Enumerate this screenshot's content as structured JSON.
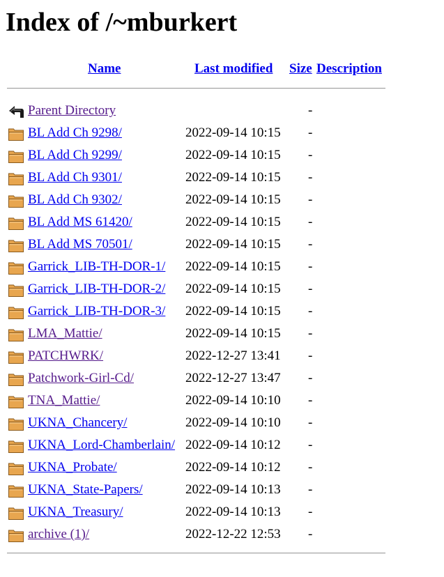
{
  "page": {
    "title": "Index of /~mburkert"
  },
  "columns": {
    "name": "Name",
    "last_modified": "Last modified",
    "size": "Size",
    "description": "Description"
  },
  "parent": {
    "label": "Parent Directory",
    "size": "-",
    "icon": "back-arrow-icon"
  },
  "entries": [
    {
      "name": "BL Add Ch 9298/",
      "modified": "2022-09-14 10:15",
      "size": "-",
      "visited": false,
      "icon": "folder-icon"
    },
    {
      "name": "BL Add Ch 9299/",
      "modified": "2022-09-14 10:15",
      "size": "-",
      "visited": false,
      "icon": "folder-icon"
    },
    {
      "name": "BL Add Ch 9301/",
      "modified": "2022-09-14 10:15",
      "size": "-",
      "visited": false,
      "icon": "folder-icon"
    },
    {
      "name": "BL Add Ch 9302/",
      "modified": "2022-09-14 10:15",
      "size": "-",
      "visited": false,
      "icon": "folder-icon"
    },
    {
      "name": "BL Add MS 61420/",
      "modified": "2022-09-14 10:15",
      "size": "-",
      "visited": false,
      "icon": "folder-icon"
    },
    {
      "name": "BL Add MS 70501/",
      "modified": "2022-09-14 10:15",
      "size": "-",
      "visited": false,
      "icon": "folder-icon"
    },
    {
      "name": "Garrick_LIB-TH-DOR-1/",
      "modified": "2022-09-14 10:15",
      "size": "-",
      "visited": false,
      "icon": "folder-icon"
    },
    {
      "name": "Garrick_LIB-TH-DOR-2/",
      "modified": "2022-09-14 10:15",
      "size": "-",
      "visited": false,
      "icon": "folder-icon"
    },
    {
      "name": "Garrick_LIB-TH-DOR-3/",
      "modified": "2022-09-14 10:15",
      "size": "-",
      "visited": false,
      "icon": "folder-icon"
    },
    {
      "name": "LMA_Mattie/",
      "modified": "2022-09-14 10:15",
      "size": "-",
      "visited": true,
      "icon": "folder-icon"
    },
    {
      "name": "PATCHWRK/",
      "modified": "2022-12-27 13:41",
      "size": "-",
      "visited": true,
      "icon": "folder-icon"
    },
    {
      "name": "Patchwork-Girl-Cd/",
      "modified": "2022-12-27 13:47",
      "size": "-",
      "visited": true,
      "icon": "folder-icon"
    },
    {
      "name": "TNA_Mattie/",
      "modified": "2022-09-14 10:10",
      "size": "-",
      "visited": true,
      "icon": "folder-icon"
    },
    {
      "name": "UKNA_Chancery/",
      "modified": "2022-09-14 10:10",
      "size": "-",
      "visited": false,
      "icon": "folder-icon"
    },
    {
      "name": "UKNA_Lord-Chamberlain/",
      "modified": "2022-09-14 10:12",
      "size": "-",
      "visited": false,
      "icon": "folder-icon"
    },
    {
      "name": "UKNA_Probate/",
      "modified": "2022-09-14 10:12",
      "size": "-",
      "visited": false,
      "icon": "folder-icon"
    },
    {
      "name": "UKNA_State-Papers/",
      "modified": "2022-09-14 10:13",
      "size": "-",
      "visited": false,
      "icon": "folder-icon"
    },
    {
      "name": "UKNA_Treasury/",
      "modified": "2022-09-14 10:13",
      "size": "-",
      "visited": false,
      "icon": "folder-icon"
    },
    {
      "name": "archive (1)/",
      "modified": "2022-12-22 12:53",
      "size": "-",
      "visited": true,
      "icon": "folder-icon"
    }
  ],
  "colors": {
    "link": "#0000ee",
    "visited": "#551a8b",
    "folder_fill": "#e8a64f",
    "folder_stroke": "#8a5a1c"
  }
}
